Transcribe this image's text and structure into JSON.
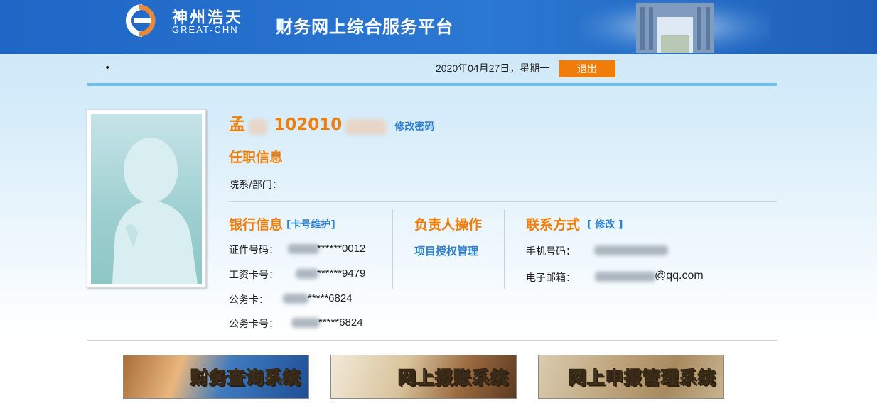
{
  "header": {
    "logo_cn": "神州浩天",
    "logo_en": "GREAT-CHN",
    "title": "财务网上综合服务平台"
  },
  "topbar": {
    "bullet": "•",
    "date": "2020年04月27日，星期一",
    "logout_label": "退出"
  },
  "profile": {
    "name": "孟",
    "id_prefix": "102010",
    "change_password": "修改密码"
  },
  "position": {
    "title": "任职信息",
    "dept_label": "院系/部门："
  },
  "bank": {
    "title": "银行信息",
    "maintain_link": "[卡号维护]",
    "rows": [
      {
        "label": "证件号码：",
        "value": "******0012"
      },
      {
        "label": "工资卡号：",
        "value": "******9479"
      },
      {
        "label": "公务卡：",
        "value": "*****6824"
      },
      {
        "label": "公务卡号：",
        "value": "*****6824"
      }
    ]
  },
  "manager": {
    "title": "负责人操作",
    "link": "项目授权管理"
  },
  "contact": {
    "title": "联系方式",
    "edit_link": "[ 修改 ]",
    "phone_label": "手机号码：",
    "email_label": "电子邮箱：",
    "email_suffix": "@qq.com"
  },
  "banners": [
    {
      "label": "财务查询系统"
    },
    {
      "label": "网上报账系统"
    },
    {
      "label": "网上申报管理系统"
    }
  ],
  "colors": {
    "header_blue": "#1f66c6",
    "accent_orange": "#f07d0a",
    "link_blue": "#2d80d0"
  }
}
